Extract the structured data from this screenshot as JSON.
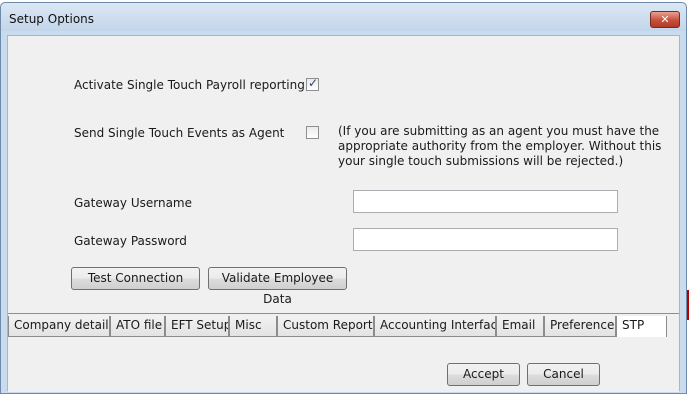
{
  "window": {
    "title": "Setup Options",
    "close_glyph": "✕"
  },
  "form": {
    "stp_label": "Activate Single Touch Payroll reporting",
    "stp_checked": true,
    "agent_label": "Send Single Touch Events as Agent",
    "agent_checked": false,
    "agent_note_line1": "(If you are submitting as an agent you must have the",
    "agent_note_line2": "appropriate authority from the employer. Without this",
    "agent_note_line3": "your single touch submissions will be rejected.)",
    "username_label": "Gateway Username",
    "username_value": "",
    "password_label": "Gateway Password",
    "password_value": "",
    "test_button": "Test Connection",
    "validate_button": "Validate Employee Data"
  },
  "tabs": [
    {
      "label": "Company details"
    },
    {
      "label": "ATO file"
    },
    {
      "label": "EFT Setup"
    },
    {
      "label": "Misc"
    },
    {
      "label": "Custom Reports"
    },
    {
      "label": "Accounting Interface"
    },
    {
      "label": "Email"
    },
    {
      "label": "Preferences"
    },
    {
      "label": "STP",
      "active": true
    }
  ],
  "footer": {
    "accept_button": "Accept",
    "cancel_button": "Cancel"
  }
}
